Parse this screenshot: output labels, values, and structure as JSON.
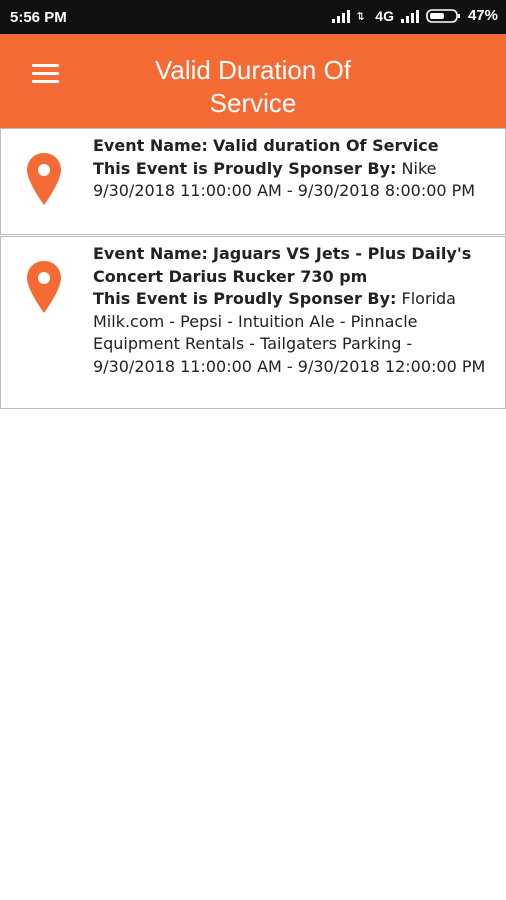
{
  "status_bar": {
    "time": "5:56 PM",
    "network": "4G",
    "battery": "47%"
  },
  "app_bar": {
    "title": "Valid Duration Of Service",
    "menu_icon": "hamburger-menu-icon",
    "color": "#f46b36"
  },
  "events": [
    {
      "name_label": "Event Name:",
      "name": "Valid duration Of Service",
      "sponsor_label": "This Event is Proudly Sponser By:",
      "sponsor": "Nike",
      "datetime": "9/30/2018 11:00:00 AM - 9/30/2018 8:00:00 PM",
      "icon": "location-pin-icon"
    },
    {
      "name_label": "Event Name:",
      "name": "Jaguars VS Jets - Plus Daily's Concert Darius Rucker 730 pm",
      "sponsor_label": "This Event is Proudly Sponser By:",
      "sponsor": "Florida Milk.com - Pepsi - Intuition Ale - Pinnacle Equipment Rentals - Tailgaters Parking -",
      "datetime": "9/30/2018 11:00:00 AM - 9/30/2018 12:00:00 PM",
      "icon": "location-pin-icon"
    }
  ]
}
